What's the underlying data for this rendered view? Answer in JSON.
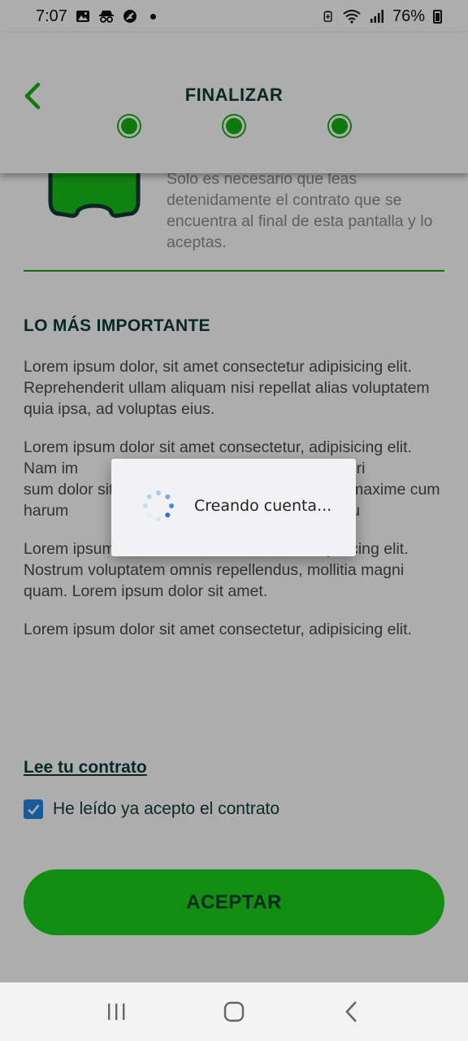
{
  "status_bar": {
    "time": "7:07",
    "battery": "76%",
    "icons": [
      "image-icon",
      "incognito-icon",
      "no-sign-icon",
      "dot-icon",
      "battery-saver-icon",
      "wifi-icon",
      "signal-icon",
      "battery-icon"
    ]
  },
  "header": {
    "back_icon": "chevron-left-icon",
    "title": "FINALIZAR",
    "steps_total": 3,
    "steps_completed": 3,
    "accent_color": "#14b314"
  },
  "intro": {
    "mascot_icon": "mascot-icon",
    "text": "Solo es necesario que leas detenidamente el contrato que se encuentra al final de esta pantalla y lo aceptas."
  },
  "section": {
    "title": "LO MÁS IMPORTANTE",
    "paragraphs": [
      "Lorem ipsum dolor, sit amet consectetur adipisicing elit. Reprehenderit ullam aliquam nisi repellat alias voluptatem quia ipsa, ad voluptas eius.",
      "Lorem ipsum dolor sit amet consectetur, adipisicing elit. Nam im                              ro placeat, esse dolori                                       sum dolor sit amet co                                        maxime cum harum                                         ecto consectetu",
      "Lorem ipsum dolor sit amet consectetur adipisicing elit. Nostrum voluptatem omnis repellendus, mollitia magni quam. Lorem ipsum dolor sit amet.",
      "Lorem ipsum dolor sit amet consectetur, adipisicing elit."
    ]
  },
  "contract": {
    "link": "Lee tu contrato",
    "checkbox_label": "He leído ya acepto el contrato",
    "checked": true,
    "checkbox_color": "#1e88e5"
  },
  "accept_button": {
    "label": "ACEPTAR",
    "color": "#1ad21a"
  },
  "dialog": {
    "message": "Creando cuenta...",
    "spinner_icon": "loading-spinner-icon"
  },
  "nav": {
    "items": [
      "recent-apps-icon",
      "home-icon",
      "back-icon"
    ]
  }
}
